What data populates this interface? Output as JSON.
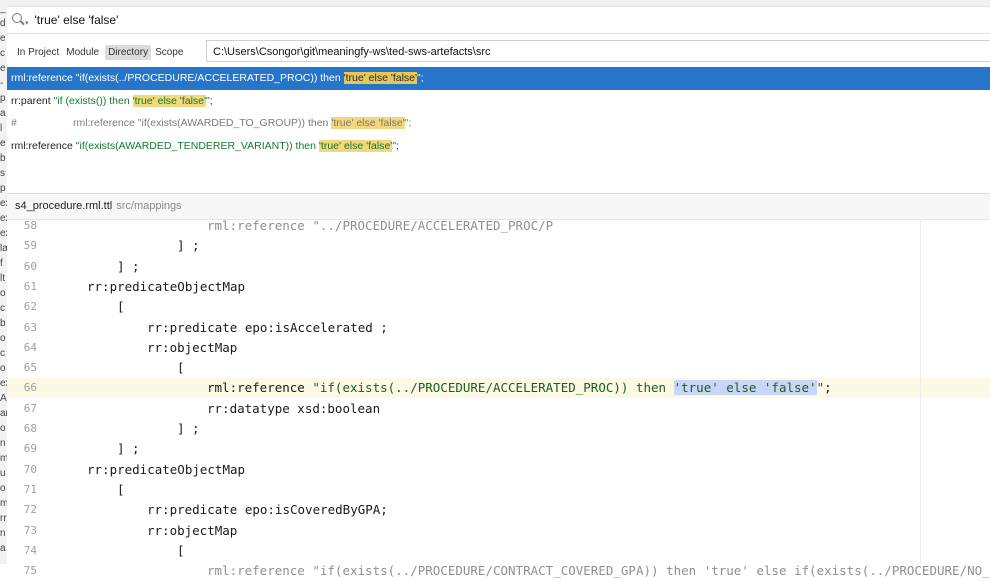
{
  "search": {
    "query": "'true' else 'false'"
  },
  "scopes": [
    {
      "label": "In Project",
      "active": false
    },
    {
      "label": "Module",
      "active": false
    },
    {
      "label": "Directory",
      "active": true
    },
    {
      "label": "Scope",
      "active": false
    }
  ],
  "directory_path": "C:\\Users\\Csongor\\git\\meaningfy-ws\\ted-sws-artefacts\\src",
  "results": [
    {
      "prefix": "rml:reference ",
      "pre": "\"if(exists(../PROCEDURE/ACCELERATED_PROC)) then ",
      "hl": "'true' else 'false'",
      "post": "\"",
      "tail": ";"
    },
    {
      "prefix": "rr:parent ",
      "pre": "\"if (exists()) then ",
      "hl": "'true' else 'false'",
      "post": "\"",
      "tail": ";"
    },
    {
      "hash": "#",
      "prefix": "rml:reference ",
      "pre": "\"if(exists(AWARDED_TO_GROUP)) then ",
      "hl": "'true' else 'false'",
      "post": "\"",
      "tail": ";"
    },
    {
      "prefix": "rml:reference ",
      "pre": "\"if(exists(AWARDED_TENDERER_VARIANT)) then ",
      "hl": "'true' else 'false'",
      "post": "\"",
      "tail": ";"
    }
  ],
  "file": {
    "name": "s4_procedure.rml.ttl",
    "path": "src/mappings"
  },
  "editor": {
    "lines": [
      {
        "num": "58",
        "code": "rml:reference \"../PROCEDURE/ACCELERATED_PROC/P"
      },
      {
        "num": "59",
        "code": "] ;"
      },
      {
        "num": "60",
        "code": "] ;"
      },
      {
        "num": "61",
        "code": "rr:predicateObjectMap"
      },
      {
        "num": "62",
        "code": "["
      },
      {
        "num": "63",
        "code": "rr:predicate epo:isAccelerated ;"
      },
      {
        "num": "64",
        "code": "rr:objectMap"
      },
      {
        "num": "65",
        "code": "["
      },
      {
        "num": "66",
        "code_pre": "rml:reference ",
        "code_str": "\"if(exists(../PROCEDURE/ACCELERATED_PROC)) then ",
        "code_hl": "'true' else 'false'",
        "code_end": "\"",
        "code_tail": ";"
      },
      {
        "num": "67",
        "code": "rr:datatype xsd:boolean"
      },
      {
        "num": "68",
        "code": "] ;"
      },
      {
        "num": "69",
        "code": "] ;"
      },
      {
        "num": "70",
        "code": "rr:predicateObjectMap"
      },
      {
        "num": "71",
        "code": "["
      },
      {
        "num": "72",
        "code": "rr:predicate epo:isCoveredByGPA;"
      },
      {
        "num": "73",
        "code": "rr:objectMap"
      },
      {
        "num": "74",
        "code": "["
      },
      {
        "num": "75",
        "code": "rml:reference \"if(exists(../PROCEDURE/CONTRACT_COVERED_GPA)) then 'true' else if(exists(../PROCEDURE/NO_CO"
      }
    ]
  },
  "left_strip_chars": [
    "_",
    "d",
    "e",
    "c",
    "e",
    "-",
    "p",
    "a",
    "l",
    "e",
    "b",
    "s",
    "p",
    "ex",
    "ex",
    "ex",
    "la",
    "f",
    "lt",
    "o",
    "c",
    "b",
    "o",
    "c",
    "o",
    "ex",
    "A",
    "ar",
    "o",
    "n",
    "m",
    "u",
    "o",
    "m",
    "rr",
    "n",
    "a"
  ]
}
